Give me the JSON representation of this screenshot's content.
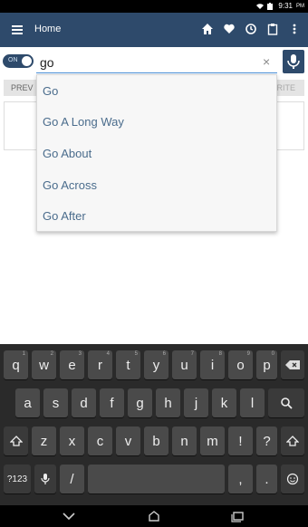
{
  "status_bar": {
    "time": "9:31",
    "ampm": "PM"
  },
  "app_bar": {
    "title": "Home"
  },
  "search": {
    "toggle_label": "ON",
    "value": "go",
    "clear_symbol": "×"
  },
  "tabs": {
    "left": "PREV",
    "right": "RITE"
  },
  "suggestions": [
    "Go",
    "Go A Long Way",
    "Go About",
    "Go Across",
    "Go After"
  ],
  "keyboard": {
    "row1": [
      {
        "k": "q",
        "s": "1"
      },
      {
        "k": "w",
        "s": "2"
      },
      {
        "k": "e",
        "s": "3"
      },
      {
        "k": "r",
        "s": "4"
      },
      {
        "k": "t",
        "s": "5"
      },
      {
        "k": "y",
        "s": "6"
      },
      {
        "k": "u",
        "s": "7"
      },
      {
        "k": "i",
        "s": "8"
      },
      {
        "k": "o",
        "s": "9"
      },
      {
        "k": "p",
        "s": "0"
      }
    ],
    "row2": [
      "a",
      "s",
      "d",
      "f",
      "g",
      "h",
      "j",
      "k",
      "l"
    ],
    "row3": [
      "z",
      "x",
      "c",
      "v",
      "b",
      "n",
      "m",
      "!",
      "?"
    ],
    "sym_label": "?123",
    "slash": "/",
    "comma": ",",
    "period": "."
  }
}
